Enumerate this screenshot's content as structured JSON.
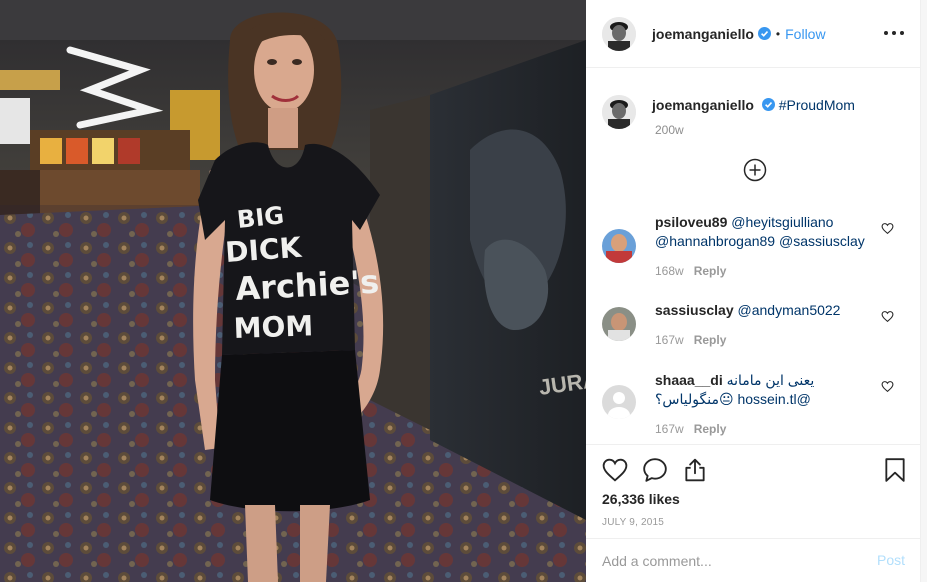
{
  "post": {
    "image_description_icon": "photo-woman-in-theater-lobby",
    "shirt_text": [
      "BIG",
      "DICK",
      "Archie's",
      "MOM"
    ],
    "sign_text": "JURASS"
  },
  "header": {
    "username": "joemanganiello",
    "verified_icon": "verified-badge-icon",
    "separator": "•",
    "follow_label": "Follow",
    "more_icon": "more-options-icon"
  },
  "caption": {
    "username": "joemanganiello",
    "text": "#ProudMom",
    "time": "200w"
  },
  "load_more_icon": "plus-circle-icon",
  "comments": [
    {
      "user": "psiloveu89",
      "text": "@heyitsgiulliano @hannahbrogan89 @sassiusclay",
      "time": "168w",
      "reply": "Reply"
    },
    {
      "user": "sassiusclay",
      "text": "@andyman5022",
      "time": "167w",
      "reply": "Reply"
    },
    {
      "user": "shaaa__di",
      "text": "یعنی این مامانه @hossein.tl 😐منگولیاس؟",
      "time": "167w",
      "reply": "Reply"
    }
  ],
  "actions": {
    "likes": "26,336 likes",
    "date": "JULY 9, 2015"
  },
  "add_comment": {
    "placeholder": "Add a comment...",
    "post_label": "Post"
  },
  "colors": {
    "link_blue": "#3897f0",
    "hashtag": "#003569",
    "muted": "#8e8e8e",
    "post_disabled": "#b2dffc"
  }
}
